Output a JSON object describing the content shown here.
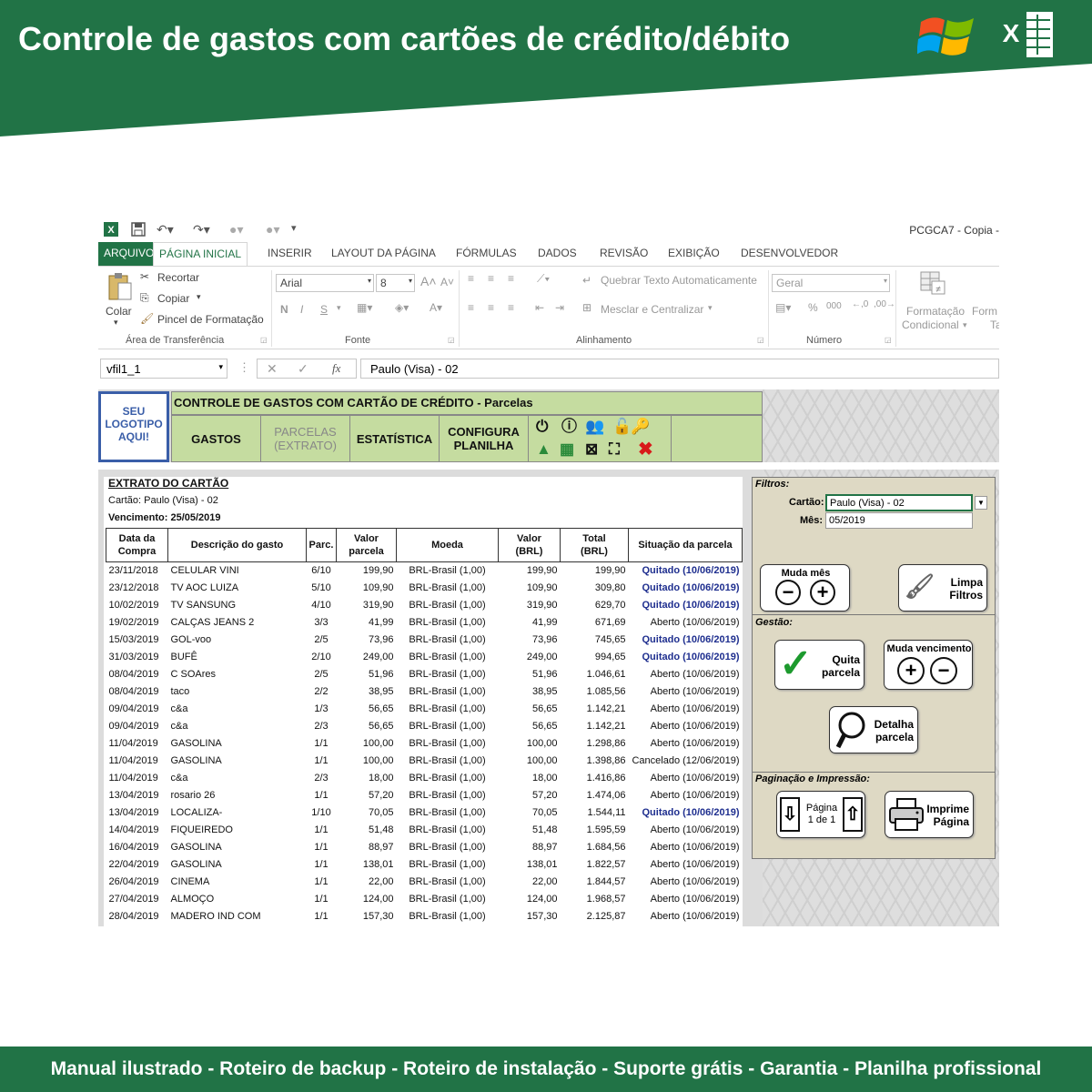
{
  "banner": {
    "title": "Controle de gastos com cartões de crédito/débito"
  },
  "footer": {
    "text": "Manual ilustrado - Roteiro de backup - Roteiro de instalação - Suporte grátis - Garantia - Planilha profissional"
  },
  "window": {
    "title": "PCGCA7 - Copia -"
  },
  "tabs": [
    "ARQUIVO",
    "PÁGINA INICIAL",
    "INSERIR",
    "LAYOUT DA PÁGINA",
    "FÓRMULAS",
    "DADOS",
    "REVISÃO",
    "EXIBIÇÃO",
    "DESENVOLVEDOR"
  ],
  "ribbon": {
    "clipboard": {
      "paste": "Colar",
      "cut": "Recortar",
      "copy": "Copiar",
      "format_painter": "Pincel de Formatação",
      "label": "Área de Transferência"
    },
    "font": {
      "name": "Arial",
      "size": "8",
      "bold": "N",
      "italic": "I",
      "underline": "S",
      "label": "Fonte"
    },
    "alignment": {
      "wrap": "Quebrar Texto Automaticamente",
      "merge": "Mesclar e Centralizar",
      "label": "Alinhamento"
    },
    "number": {
      "format": "Geral",
      "label": "Número"
    },
    "styles": {
      "conditional_line1": "Formatação",
      "conditional_line2": "Condicional",
      "next_line1": "Form",
      "next_line2": "Ta"
    }
  },
  "formula_bar": {
    "name_box": "vfil1_1",
    "fx": "fx",
    "formula": "Paulo (Visa) - 02"
  },
  "sheet": {
    "logo_lines": [
      "SEU",
      "LOGOTIPO",
      "AQUI!"
    ],
    "header_title": "CONTROLE DE GASTOS COM CARTÃO DE CRÉDITO  -  Parcelas",
    "nav": [
      {
        "line1": "GASTOS",
        "line2": ""
      },
      {
        "line1": "PARCELAS",
        "line2": "(EXTRATO)"
      },
      {
        "line1": "ESTATÍSTICA",
        "line2": ""
      },
      {
        "line1": "CONFIGURA",
        "line2": "PLANILHA"
      }
    ]
  },
  "extract": {
    "title": "EXTRATO DO CARTÃO",
    "card": "Cartão: Paulo (Visa) - 02",
    "due": "Vencimento: 25/05/2019",
    "columns": [
      {
        "line1": "Data da",
        "line2": "Compra"
      },
      {
        "line1": "Descrição do gasto",
        "line2": ""
      },
      {
        "line1": "Parc.",
        "line2": ""
      },
      {
        "line1": "Valor",
        "line2": "parcela"
      },
      {
        "line1": "Moeda",
        "line2": ""
      },
      {
        "line1": "Valor",
        "line2": "(BRL)"
      },
      {
        "line1": "Total",
        "line2": "(BRL)"
      },
      {
        "line1": "Situação da parcela",
        "line2": ""
      }
    ],
    "rows": [
      [
        "23/11/2018",
        "CELULAR VINI",
        "6/10",
        "199,90",
        "BRL-Brasil (1,00)",
        "199,90",
        "199,90",
        "Quitado (10/06/2019)"
      ],
      [
        "23/12/2018",
        "TV AOC LUIZA",
        "5/10",
        "109,90",
        "BRL-Brasil (1,00)",
        "109,90",
        "309,80",
        "Quitado (10/06/2019)"
      ],
      [
        "10/02/2019",
        "TV SANSUNG",
        "4/10",
        "319,90",
        "BRL-Brasil (1,00)",
        "319,90",
        "629,70",
        "Quitado (10/06/2019)"
      ],
      [
        "19/02/2019",
        "CALÇAS JEANS 2",
        "3/3",
        "41,99",
        "BRL-Brasil (1,00)",
        "41,99",
        "671,69",
        "Aberto (10/06/2019)"
      ],
      [
        "15/03/2019",
        "GOL-voo",
        "2/5",
        "73,96",
        "BRL-Brasil (1,00)",
        "73,96",
        "745,65",
        "Quitado (10/06/2019)"
      ],
      [
        "31/03/2019",
        "BUFÊ",
        "2/10",
        "249,00",
        "BRL-Brasil (1,00)",
        "249,00",
        "994,65",
        "Quitado (10/06/2019)"
      ],
      [
        "08/04/2019",
        "C SOAres",
        "2/5",
        "51,96",
        "BRL-Brasil (1,00)",
        "51,96",
        "1.046,61",
        "Aberto (10/06/2019)"
      ],
      [
        "08/04/2019",
        "taco",
        "2/2",
        "38,95",
        "BRL-Brasil (1,00)",
        "38,95",
        "1.085,56",
        "Aberto (10/06/2019)"
      ],
      [
        "09/04/2019",
        "c&a",
        "1/3",
        "56,65",
        "BRL-Brasil (1,00)",
        "56,65",
        "1.142,21",
        "Aberto (10/06/2019)"
      ],
      [
        "09/04/2019",
        "c&a",
        "2/3",
        "56,65",
        "BRL-Brasil (1,00)",
        "56,65",
        "1.142,21",
        "Aberto (10/06/2019)"
      ],
      [
        "11/04/2019",
        "GASOLINA",
        "1/1",
        "100,00",
        "BRL-Brasil (1,00)",
        "100,00",
        "1.298,86",
        "Aberto (10/06/2019)"
      ],
      [
        "11/04/2019",
        "GASOLINA",
        "1/1",
        "100,00",
        "BRL-Brasil (1,00)",
        "100,00",
        "1.398,86",
        "Cancelado (12/06/2019)"
      ],
      [
        "11/04/2019",
        "c&a",
        "2/3",
        "18,00",
        "BRL-Brasil (1,00)",
        "18,00",
        "1.416,86",
        "Aberto (10/06/2019)"
      ],
      [
        "13/04/2019",
        "rosario 26",
        "1/1",
        "57,20",
        "BRL-Brasil (1,00)",
        "57,20",
        "1.474,06",
        "Aberto (10/06/2019)"
      ],
      [
        "13/04/2019",
        "LOCALIZA-",
        "1/10",
        "70,05",
        "BRL-Brasil (1,00)",
        "70,05",
        "1.544,11",
        "Quitado (10/06/2019)"
      ],
      [
        "14/04/2019",
        "FIQUEIREDO",
        "1/1",
        "51,48",
        "BRL-Brasil (1,00)",
        "51,48",
        "1.595,59",
        "Aberto (10/06/2019)"
      ],
      [
        "16/04/2019",
        "GASOLINA",
        "1/1",
        "88,97",
        "BRL-Brasil (1,00)",
        "88,97",
        "1.684,56",
        "Aberto (10/06/2019)"
      ],
      [
        "22/04/2019",
        "GASOLINA",
        "1/1",
        "138,01",
        "BRL-Brasil (1,00)",
        "138,01",
        "1.822,57",
        "Aberto (10/06/2019)"
      ],
      [
        "26/04/2019",
        "CINEMA",
        "1/1",
        "22,00",
        "BRL-Brasil (1,00)",
        "22,00",
        "1.844,57",
        "Aberto (10/06/2019)"
      ],
      [
        "27/04/2019",
        "ALMOÇO",
        "1/1",
        "124,00",
        "BRL-Brasil (1,00)",
        "124,00",
        "1.968,57",
        "Aberto (10/06/2019)"
      ],
      [
        "28/04/2019",
        "MADERO IND COM",
        "1/1",
        "157,30",
        "BRL-Brasil (1,00)",
        "157,30",
        "2.125,87",
        "Aberto (10/06/2019)"
      ]
    ]
  },
  "panel": {
    "filters_label": "Filtros:",
    "card_label": "Cartão:",
    "card_value": "Paulo (Visa) - 02",
    "month_label": "Mês:",
    "month_value": "05/2019",
    "change_month": "Muda mês",
    "clear_1": "Limpa",
    "clear_2": "Filtros",
    "management_label": "Gestão:",
    "settle_1": "Quita",
    "settle_2": "parcela",
    "change_due": "Muda vencimento",
    "detail_1": "Detalha",
    "detail_2": "parcela",
    "paging_label": "Paginação e Impressão:",
    "page_1": "Página",
    "page_2": "1 de 1",
    "print_1": "Imprime",
    "print_2": "Página"
  },
  "colors": {
    "brand": "#217346",
    "header_green": "#c5dca0",
    "panel": "#ded9c4",
    "paid_blue": "#1f2f8f"
  }
}
